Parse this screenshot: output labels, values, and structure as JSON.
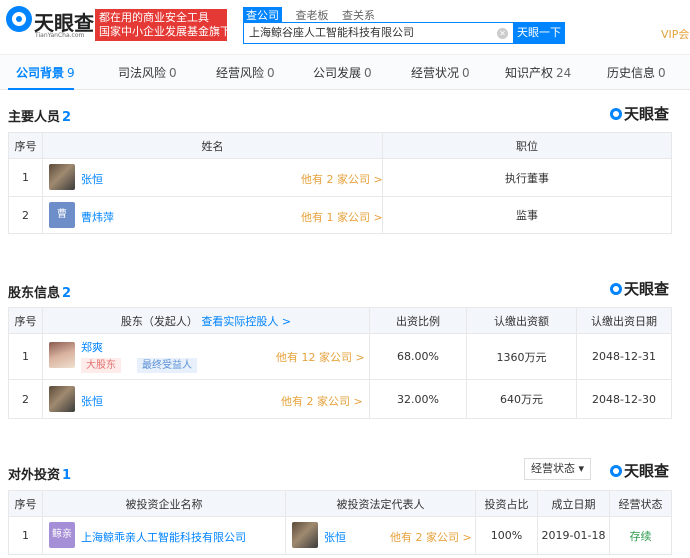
{
  "header": {
    "logo_text": "天眼查",
    "logo_sub": "TianYanCha.com",
    "banner_line1": "都在用的商业安全工具",
    "banner_line2": "国家中小企业发展基金旗下",
    "search_tabs": [
      "查公司",
      "查老板",
      "查关系"
    ],
    "search_value": "上海鲸谷座人工智能科技有限公司",
    "search_button": "天眼一下",
    "vip_label": "VIP会员"
  },
  "nav": {
    "tabs": [
      {
        "label": "公司背景",
        "count": "9"
      },
      {
        "label": "司法风险",
        "count": "0"
      },
      {
        "label": "经营风险",
        "count": "0"
      },
      {
        "label": "公司发展",
        "count": "0"
      },
      {
        "label": "经营状况",
        "count": "0"
      },
      {
        "label": "知识产权",
        "count": "24"
      },
      {
        "label": "历史信息",
        "count": "0"
      }
    ]
  },
  "brand_label": "天眼查",
  "personnel": {
    "title": "主要人员",
    "count": "2",
    "headers": [
      "序号",
      "姓名",
      "职位"
    ],
    "rows": [
      {
        "index": "1",
        "name": "张恒",
        "avatar_text": "",
        "other": "他有 2 家公司 >",
        "position": "执行董事"
      },
      {
        "index": "2",
        "name": "曹炜萍",
        "avatar_text": "曹",
        "other": "他有 1 家公司 >",
        "position": "监事"
      }
    ]
  },
  "shareholders": {
    "title": "股东信息",
    "count": "2",
    "headers": [
      "序号",
      "股东（发起人）",
      "查看实际控股人 >",
      "出资比例",
      "认缴出资额",
      "认缴出资日期"
    ],
    "rows": [
      {
        "index": "1",
        "name": "郑爽",
        "tags": [
          "大股东",
          "最终受益人"
        ],
        "other": "他有 12 家公司 >",
        "ratio": "68.00%",
        "amount": "1360万元",
        "date": "2048-12-31"
      },
      {
        "index": "2",
        "name": "张恒",
        "tags": [],
        "other": "他有 2 家公司 >",
        "ratio": "32.00%",
        "amount": "640万元",
        "date": "2048-12-30"
      }
    ]
  },
  "investments": {
    "title": "对外投资",
    "count": "1",
    "filter_label": "经营状态",
    "headers": [
      "序号",
      "被投资企业名称",
      "被投资法定代表人",
      "投资占比",
      "成立日期",
      "经营状态"
    ],
    "rows": [
      {
        "index": "1",
        "company_avatar": "鲸亲",
        "company": "上海鲸乖亲人工智能科技有限公司",
        "rep": "张恒",
        "rep_other": "他有 2 家公司 >",
        "ratio": "100%",
        "date": "2019-01-18",
        "status": "存续"
      }
    ]
  },
  "colors": {
    "accent": "#0084ff",
    "orange": "#e6a23c",
    "banner": "#e53935",
    "green": "#2e9b4e"
  }
}
